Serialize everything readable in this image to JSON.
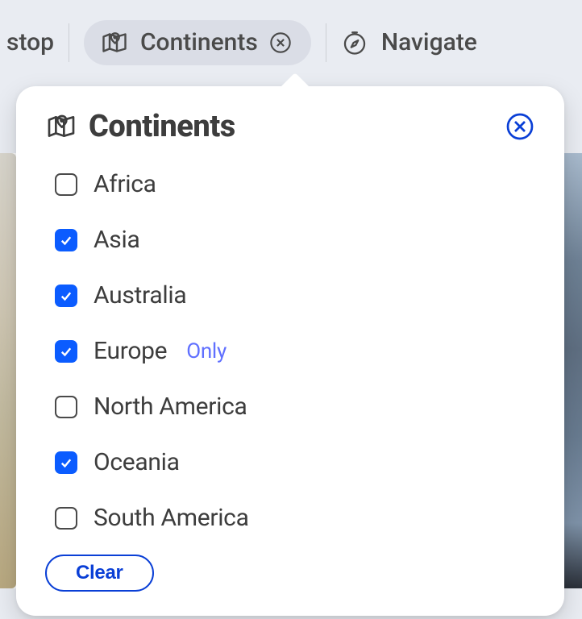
{
  "topbar": {
    "left_fragment": "stop",
    "pill_label": "Continents",
    "nav_label": "Navigate"
  },
  "popover": {
    "title": "Continents",
    "clear_label": "Clear",
    "only_label": "Only",
    "items": [
      {
        "label": "Africa",
        "checked": false,
        "show_only": false
      },
      {
        "label": "Asia",
        "checked": true,
        "show_only": false
      },
      {
        "label": "Australia",
        "checked": true,
        "show_only": false
      },
      {
        "label": "Europe",
        "checked": true,
        "show_only": true
      },
      {
        "label": "North America",
        "checked": false,
        "show_only": false
      },
      {
        "label": "Oceania",
        "checked": true,
        "show_only": false
      },
      {
        "label": "South America",
        "checked": false,
        "show_only": false
      }
    ]
  }
}
